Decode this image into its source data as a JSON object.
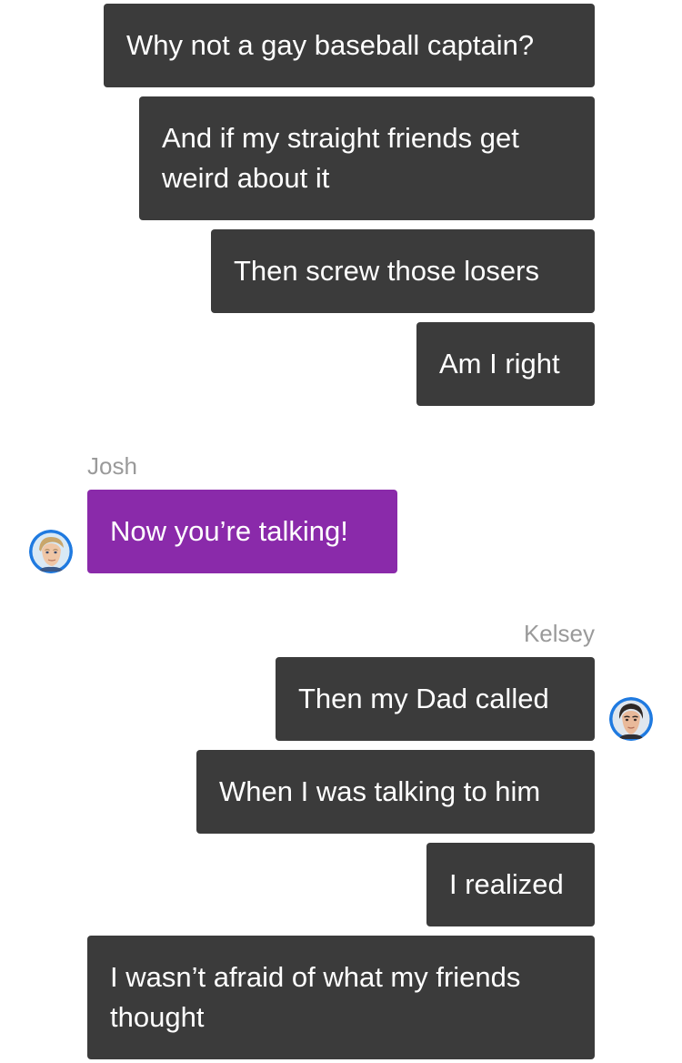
{
  "messages": [
    {
      "text": "Why not a gay baseball captain?"
    },
    {
      "text": "And if my straight friends get weird about it"
    },
    {
      "text": "Then screw those losers"
    },
    {
      "text": "Am I right"
    },
    {
      "text": "Now you’re talking!"
    },
    {
      "text": "Then my Dad called"
    },
    {
      "text": "When I was talking to him"
    },
    {
      "text": "I realized"
    },
    {
      "text": "I wasn’t afraid of what my friends thought"
    }
  ],
  "senders": {
    "josh": "Josh",
    "kelsey": "Kelsey"
  },
  "colors": {
    "bubble_dark": "#3b3b3b",
    "bubble_purple": "#8a2aaa",
    "sender_name": "#9a9a9a",
    "avatar_ring": "#1f7ae0"
  },
  "icons": {
    "josh_avatar": "avatar-josh-icon",
    "kelsey_avatar": "avatar-kelsey-icon"
  }
}
